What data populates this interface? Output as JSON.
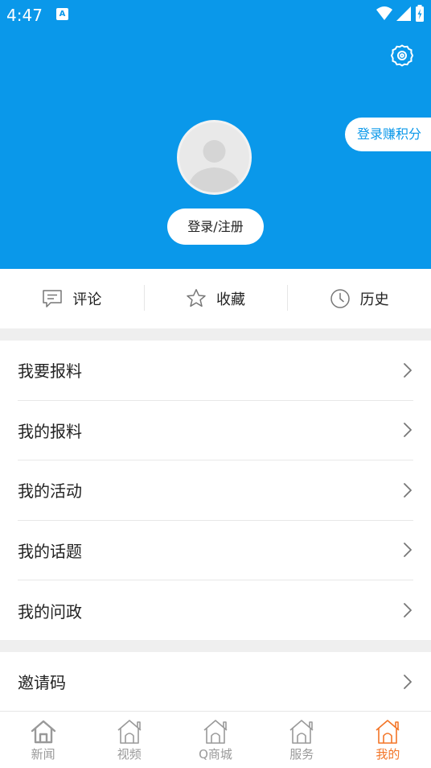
{
  "status": {
    "time": "4:47",
    "notif_badge": "A"
  },
  "header": {
    "points_label": "登录赚积分",
    "login_label": "登录/注册"
  },
  "quick_actions": [
    {
      "label": "评论",
      "icon": "comment-icon"
    },
    {
      "label": "收藏",
      "icon": "star-icon"
    },
    {
      "label": "历史",
      "icon": "clock-icon"
    }
  ],
  "menu_group1": [
    {
      "label": "我要报料"
    },
    {
      "label": "我的报料"
    },
    {
      "label": "我的活动"
    },
    {
      "label": "我的话题"
    },
    {
      "label": "我的问政"
    }
  ],
  "menu_group2": [
    {
      "label": "邀请码"
    }
  ],
  "tabs": [
    {
      "label": "新闻",
      "icon": "home-icon",
      "active": false
    },
    {
      "label": "视频",
      "icon": "house-icon",
      "active": false
    },
    {
      "label": "Q商城",
      "icon": "house-icon",
      "active": false
    },
    {
      "label": "服务",
      "icon": "house-icon",
      "active": false
    },
    {
      "label": "我的",
      "icon": "house-icon",
      "active": true
    }
  ],
  "colors": {
    "brand_blue": "#0a98ea",
    "active_orange": "#f37527",
    "inactive_gray": "#999999"
  }
}
